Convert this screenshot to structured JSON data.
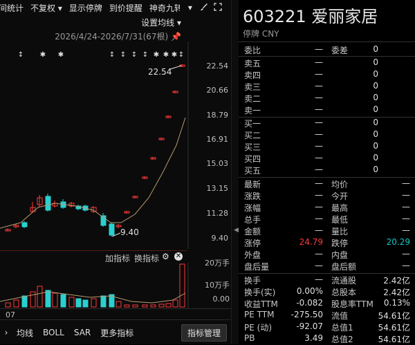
{
  "toolbar": {
    "items": [
      "间统计",
      "不复权 ▾",
      "显示停牌",
      "到价提醒",
      "神奇九转"
    ],
    "brush_icon": "brush-icon",
    "dropdown_icon": "chevron-down-icon",
    "expand_icon": "expand-icon"
  },
  "chart": {
    "set_ma_label": "设置均线 ▾",
    "date_range": "2026/4/24-2026/7/31(67根)",
    "pin_icon": "pin-icon",
    "y_ticks": [
      "22.54",
      "20.66",
      "18.79",
      "16.91",
      "15.03",
      "13.15",
      "11.28",
      "9.40"
    ],
    "high_label": "22.54",
    "low_label": "9.40",
    "markers": [
      "↕",
      "✱",
      "✱",
      "↕",
      "↕",
      "↕",
      "↕",
      "✱",
      "✱",
      "✱",
      "↕"
    ],
    "colors": {
      "up": "#ff3a3a",
      "down": "#2ad0d0",
      "ma": "#b89a70"
    }
  },
  "indicator_bar": {
    "add_label": "加指标",
    "switch_label": "换指标",
    "gear_icon": "gear-icon",
    "close_icon": "close-icon"
  },
  "volume": {
    "y_ticks": [
      "20万手",
      "10万手",
      "0.00"
    ]
  },
  "date_axis": {
    "label": "07"
  },
  "bottom_bar": {
    "items": [
      "均线",
      "BOLL",
      "SAR",
      "更多指标"
    ],
    "manage_label": "指标管理"
  },
  "quote": {
    "code_name": "603221 爱丽家居",
    "status": "停牌 CNY",
    "header": {
      "weibi_label": "委比",
      "weibi_val": "—",
      "weicha_label": "委差",
      "weicha_val": "0"
    },
    "sell": [
      {
        "label": "卖五",
        "price": "—",
        "vol": "0"
      },
      {
        "label": "卖四",
        "price": "—",
        "vol": "0"
      },
      {
        "label": "卖三",
        "price": "—",
        "vol": "0"
      },
      {
        "label": "卖二",
        "price": "—",
        "vol": "0"
      },
      {
        "label": "卖一",
        "price": "—",
        "vol": "0"
      }
    ],
    "buy": [
      {
        "label": "买一",
        "price": "—",
        "vol": "0"
      },
      {
        "label": "买二",
        "price": "—",
        "vol": "0"
      },
      {
        "label": "买三",
        "price": "—",
        "vol": "0"
      },
      {
        "label": "买四",
        "price": "—",
        "vol": "0"
      },
      {
        "label": "买五",
        "price": "—",
        "vol": "0"
      }
    ],
    "stats1": [
      {
        "l1": "最新",
        "v1": "—",
        "l2": "均价",
        "v2": "—"
      },
      {
        "l1": "涨跌",
        "v1": "—",
        "l2": "今开",
        "v2": "—"
      },
      {
        "l1": "涨幅",
        "v1": "—",
        "l2": "最高",
        "v2": "—"
      },
      {
        "l1": "总手",
        "v1": "—",
        "l2": "最低",
        "v2": "—"
      },
      {
        "l1": "金额",
        "v1": "—",
        "l2": "量比",
        "v2": "—"
      },
      {
        "l1": "涨停",
        "v1": "24.79",
        "l2": "跌停",
        "v2": "20.29"
      },
      {
        "l1": "外盘",
        "v1": "—",
        "l2": "内盘",
        "v2": "—"
      },
      {
        "l1": "盘后量",
        "v1": "—",
        "l2": "盘后额",
        "v2": "—"
      }
    ],
    "stats2": [
      {
        "l1": "换手",
        "v1": "—",
        "l2": "流通股",
        "v2": "2.42亿"
      },
      {
        "l1": "换手(实)",
        "v1": "0.00%",
        "l2": "总股本",
        "v2": "2.42亿"
      },
      {
        "l1": "收益TTM",
        "v1": "-0.082",
        "l2": "股息率TTM",
        "v2": "0.13%"
      },
      {
        "l1": "PE TTM",
        "v1": "-275.50",
        "l2": "流值",
        "v2": "54.61亿"
      },
      {
        "l1": "PE (动)",
        "v1": "-92.07",
        "l2": "总值1",
        "v2": "54.61亿"
      },
      {
        "l1": "PB",
        "v1": "3.49",
        "l2": "总值2",
        "v2": "54.61亿"
      }
    ],
    "colors": {
      "limit_up": "#ff3a3a",
      "limit_down": "#14c8c8"
    }
  }
}
